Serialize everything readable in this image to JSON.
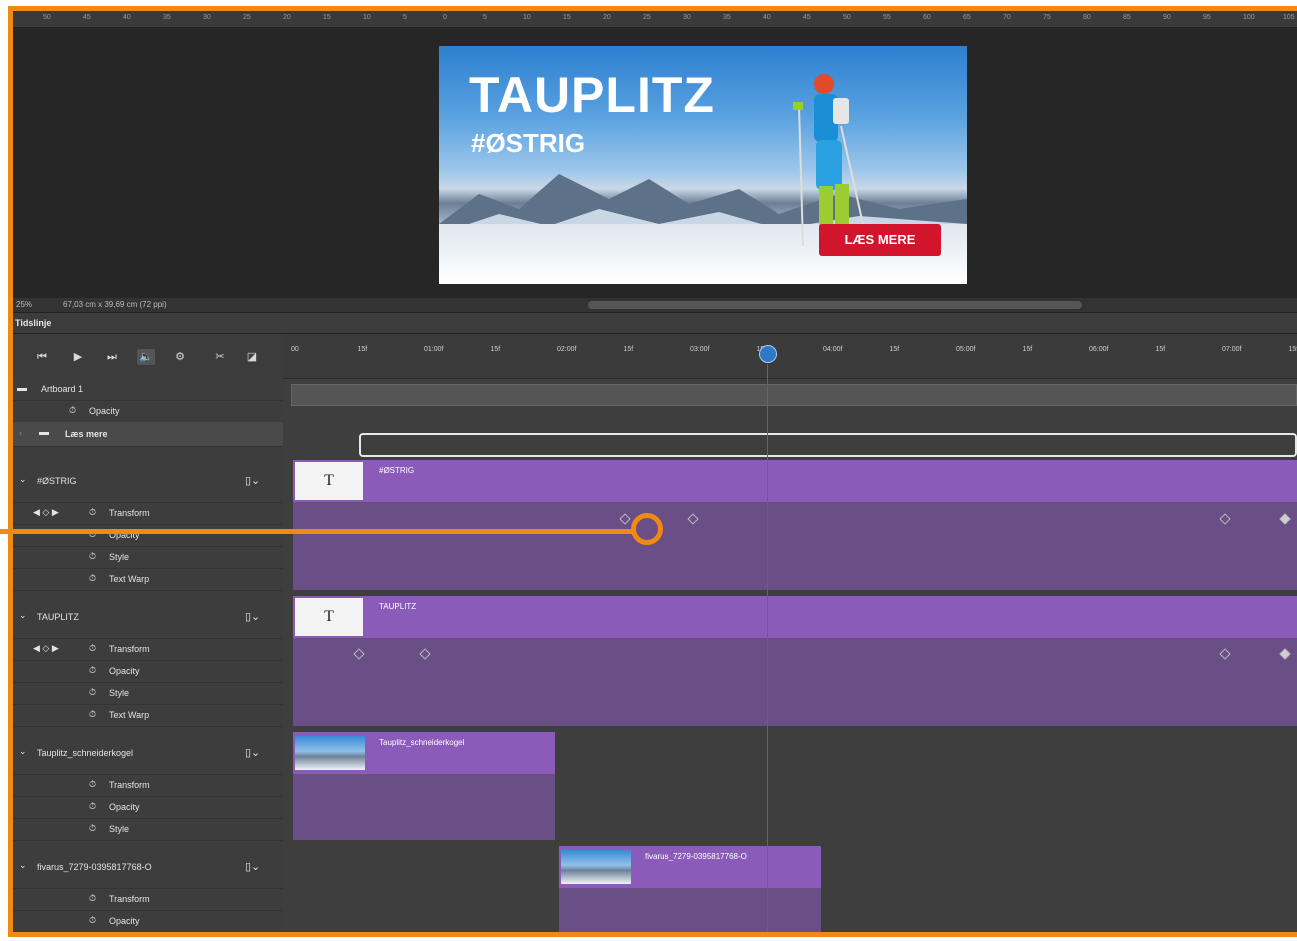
{
  "ruler_ticks": [
    "50",
    "45",
    "40",
    "35",
    "30",
    "25",
    "20",
    "15",
    "10",
    "5",
    "0",
    "5",
    "10",
    "15",
    "20",
    "25",
    "30",
    "35",
    "40",
    "45",
    "50",
    "55",
    "60",
    "65",
    "70",
    "75",
    "80",
    "85",
    "90",
    "95",
    "100",
    "105"
  ],
  "artboard": {
    "title": "TAUPLITZ",
    "subtitle": "#ØSTRIG",
    "cta": "LÆS MERE"
  },
  "status": {
    "zoom": "25%",
    "doc_info": "67,03 cm x 39,69 cm (72 ppi)"
  },
  "panel": {
    "title": "Tidslinje"
  },
  "controls": [
    "⏮",
    "▶",
    "⏭",
    "🔈",
    "⚙",
    "✂",
    "◪"
  ],
  "timecodes": [
    "00",
    "15f",
    "01:00f",
    "15f",
    "02:00f",
    "15f",
    "03:00f",
    "15f",
    "04:00f",
    "15f",
    "05:00f",
    "15f",
    "06:00f",
    "15f",
    "07:00f",
    "15f"
  ],
  "layers": {
    "artboard": "Artboard 1",
    "artboard_opacity": "Opacity",
    "group": "Læs mere",
    "layer1": "#ØSTRIG",
    "layer2": "TAUPLITZ",
    "layer3": "Tauplitz_schneiderkogel",
    "layer4": "fivarus_7279-0395817768-O",
    "prop_transform": "Transform",
    "prop_opacity": "Opacity",
    "prop_style": "Style",
    "prop_textwarp": "Text Warp"
  },
  "clips": {
    "c1": "#ØSTRIG",
    "c2": "TAUPLITZ",
    "c3": "Tauplitz_schneiderkogel",
    "c4": "fivarus_7279-0395817768-O"
  },
  "colors": {
    "annotation": "#f08a14",
    "clip": "#8a5bb8",
    "playhead": "#dd3333",
    "cta": "#d3142d"
  }
}
